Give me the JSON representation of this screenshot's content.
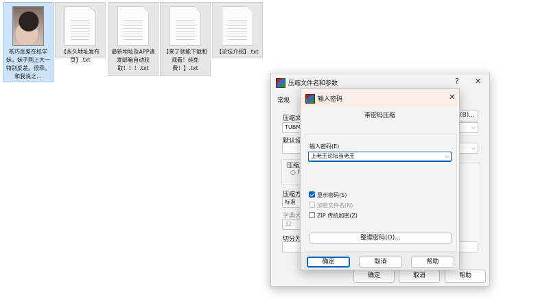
{
  "desktop": {
    "files": [
      {
        "name": "祇巧反差在校学妹，妹子刚上大一 特别反差。很乖。和我说之...",
        "kind": "video"
      },
      {
        "name": "【永久地址发布页】.txt",
        "kind": "text"
      },
      {
        "name": "最新地址及APP请发邮箱自动获取！！！.txt",
        "kind": "text"
      },
      {
        "name": "【来了就能下载和观看！纯免费！】.txt",
        "kind": "text"
      },
      {
        "name": "【论坛介绍】.txt",
        "kind": "text"
      }
    ]
  },
  "archive_dialog": {
    "title": "压缩文件名和参数",
    "help_glyph": "?",
    "close_glyph": "✕",
    "tab_general": "常规",
    "archive_name_label": "压缩文",
    "archive_name_value": "TUBMI",
    "browse_label": "(B)...",
    "default_profile_label": "默认设",
    "format_label": "压缩文",
    "format_radio_partial": "R",
    "method_label": "压缩方",
    "method_value": "标准",
    "dict_label": "字典大",
    "dict_value": "32",
    "split_label": "切分为",
    "ok": "确定",
    "cancel": "取消",
    "help": "帮助"
  },
  "password_dialog": {
    "title": "输入密码",
    "close_glyph": "✕",
    "header": "带密码压缩",
    "password_label": "输入密码(E)",
    "password_value": "上老王论坛当老王",
    "show_password": {
      "label": "显示密码(S)",
      "checked": true
    },
    "encrypt_names": {
      "label": "加密文件名(N)",
      "checked": false,
      "disabled": true
    },
    "zip_legacy": {
      "label": "ZIP 传统加密(Z)",
      "checked": false
    },
    "organize_button": "整理密码(O)...",
    "ok": "确定",
    "cancel": "取消",
    "help": "帮助"
  }
}
